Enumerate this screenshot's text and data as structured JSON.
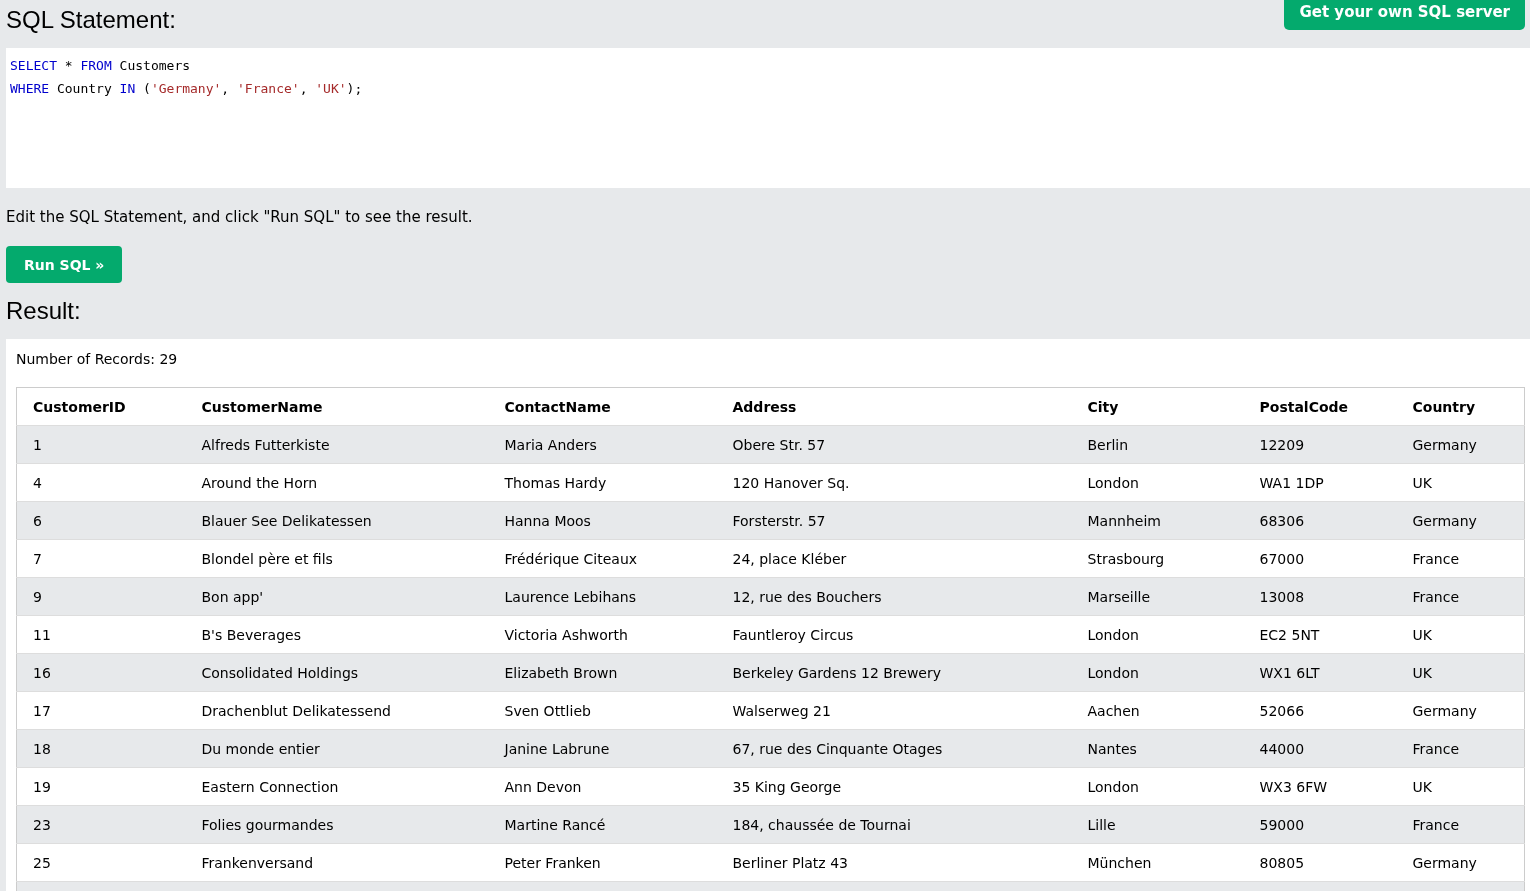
{
  "heading": "SQL Statement:",
  "server_button": "Get your own SQL server",
  "sql_lines": [
    [
      {
        "kind": "keyword",
        "text": "SELECT"
      },
      {
        "kind": "plain",
        "text": " * "
      },
      {
        "kind": "keyword",
        "text": "FROM"
      },
      {
        "kind": "plain",
        "text": " Customers"
      }
    ],
    [
      {
        "kind": "keyword",
        "text": "WHERE"
      },
      {
        "kind": "plain",
        "text": " Country "
      },
      {
        "kind": "keyword",
        "text": "IN"
      },
      {
        "kind": "plain",
        "text": " ("
      },
      {
        "kind": "string",
        "text": "'Germany'"
      },
      {
        "kind": "plain",
        "text": ", "
      },
      {
        "kind": "string",
        "text": "'France'"
      },
      {
        "kind": "plain",
        "text": ", "
      },
      {
        "kind": "string",
        "text": "'UK'"
      },
      {
        "kind": "plain",
        "text": ");"
      }
    ]
  ],
  "instructions": "Edit the SQL Statement, and click \"Run SQL\" to see the result.",
  "run_button": "Run SQL »",
  "result_heading": "Result:",
  "record_count": "Number of Records: 29",
  "table": {
    "columns": [
      "CustomerID",
      "CustomerName",
      "ContactName",
      "Address",
      "City",
      "PostalCode",
      "Country"
    ],
    "rows": [
      [
        "1",
        "Alfreds Futterkiste",
        "Maria Anders",
        "Obere Str. 57",
        "Berlin",
        "12209",
        "Germany"
      ],
      [
        "4",
        "Around the Horn",
        "Thomas Hardy",
        "120 Hanover Sq.",
        "London",
        "WA1 1DP",
        "UK"
      ],
      [
        "6",
        "Blauer See Delikatessen",
        "Hanna Moos",
        "Forsterstr. 57",
        "Mannheim",
        "68306",
        "Germany"
      ],
      [
        "7",
        "Blondel père et fils",
        "Frédérique Citeaux",
        "24, place Kléber",
        "Strasbourg",
        "67000",
        "France"
      ],
      [
        "9",
        "Bon app'",
        "Laurence Lebihans",
        "12, rue des Bouchers",
        "Marseille",
        "13008",
        "France"
      ],
      [
        "11",
        "B's Beverages",
        "Victoria Ashworth",
        "Fauntleroy Circus",
        "London",
        "EC2 5NT",
        "UK"
      ],
      [
        "16",
        "Consolidated Holdings",
        "Elizabeth Brown",
        "Berkeley Gardens 12 Brewery",
        "London",
        "WX1 6LT",
        "UK"
      ],
      [
        "17",
        "Drachenblut Delikatessend",
        "Sven Ottlieb",
        "Walserweg 21",
        "Aachen",
        "52066",
        "Germany"
      ],
      [
        "18",
        "Du monde entier",
        "Janine Labrune",
        "67, rue des Cinquante Otages",
        "Nantes",
        "44000",
        "France"
      ],
      [
        "19",
        "Eastern Connection",
        "Ann Devon",
        "35 King George",
        "London",
        "WX3 6FW",
        "UK"
      ],
      [
        "23",
        "Folies gourmandes",
        "Martine Rancé",
        "184, chaussée de Tournai",
        "Lille",
        "59000",
        "France"
      ],
      [
        "25",
        "Frankenversand",
        "Peter Franken",
        "Berliner Platz 43",
        "München",
        "80805",
        "Germany"
      ]
    ]
  }
}
